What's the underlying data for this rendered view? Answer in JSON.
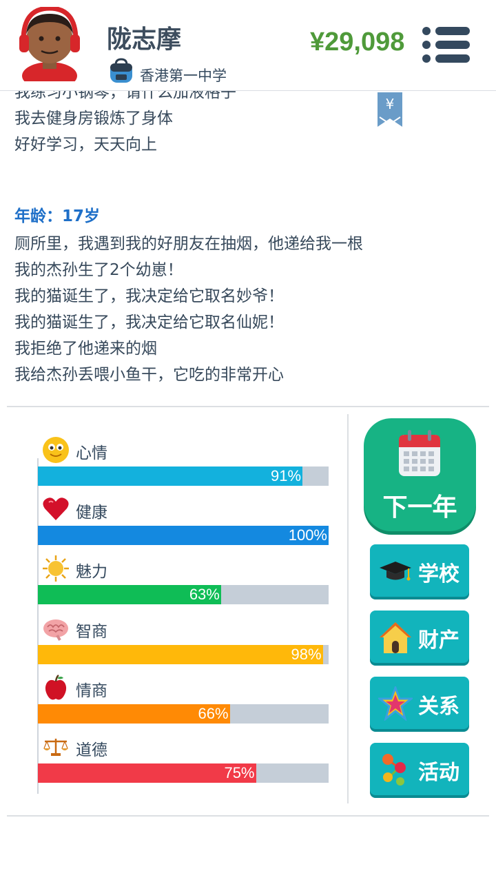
{
  "header": {
    "name": "陇志摩",
    "school": "香港第一中学",
    "money": "¥29,098"
  },
  "log": {
    "cut_line": "我练习小钢琴，请什么加液格子",
    "lines_prev": [
      "我去健身房锻炼了身体",
      "好好学习，天天向上"
    ],
    "age_label": "年龄：17岁",
    "lines": [
      "厕所里，我遇到我的好朋友在抽烟，他递给我一根",
      "我的杰孙生了2个幼崽！",
      "我的猫诞生了，我决定给它取名妙爷！",
      "我的猫诞生了，我决定给它取名仙妮！",
      "我拒绝了他递来的烟",
      "我给杰孙丢喂小鱼干，它吃的非常开心"
    ],
    "bookmark_symbol": "¥"
  },
  "stats": [
    {
      "icon": "smiley-icon",
      "label": "心情",
      "value": 91,
      "pct": "91%",
      "color": "#13b1dd"
    },
    {
      "icon": "heart-icon",
      "label": "健康",
      "value": 100,
      "pct": "100%",
      "color": "#1489e0"
    },
    {
      "icon": "sun-icon",
      "label": "魅力",
      "value": 63,
      "pct": "63%",
      "color": "#0fbd56"
    },
    {
      "icon": "brain-icon",
      "label": "智商",
      "value": 98,
      "pct": "98%",
      "color": "#ffb80a"
    },
    {
      "icon": "apple-icon",
      "label": "情商",
      "value": 66,
      "pct": "66%",
      "color": "#ff8a05"
    },
    {
      "icon": "scales-icon",
      "label": "道德",
      "value": 75,
      "pct": "75%",
      "color": "#f13a48"
    }
  ],
  "actions": {
    "next_year": "下一年",
    "school": "学校",
    "property": "财产",
    "relations": "关系",
    "activities": "活动"
  }
}
